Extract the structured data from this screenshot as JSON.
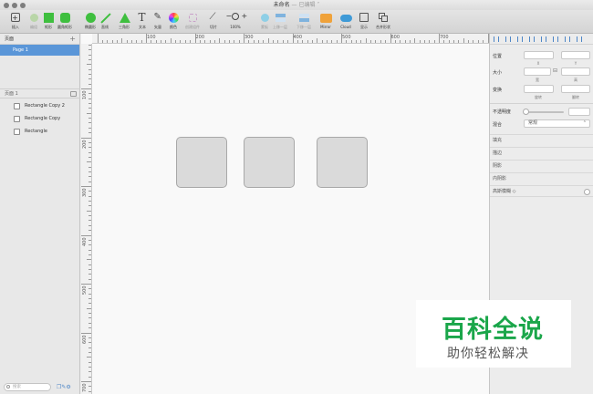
{
  "window": {
    "title": "未命名",
    "subtitle": " — 已编辑 ˅"
  },
  "toolbar": {
    "tools": [
      {
        "label": "插入",
        "icon": "plus-icon"
      },
      {
        "label": "编组",
        "icon": "group-icon"
      },
      {
        "label": "矩形",
        "icon": "rectangle-icon"
      },
      {
        "label": "圆角矩形",
        "icon": "rounded-rectangle-icon"
      },
      {
        "label": "椭圆形",
        "icon": "oval-icon"
      },
      {
        "label": "直线",
        "icon": "line-icon"
      },
      {
        "label": "三角形",
        "icon": "triangle-icon"
      },
      {
        "label": "文本",
        "icon": "text-icon"
      },
      {
        "label": "矢量",
        "icon": "vector-pen-icon"
      },
      {
        "label": "颜色",
        "icon": "color-wheel-icon"
      },
      {
        "label": "创建组件",
        "icon": "symbol-icon"
      },
      {
        "label": "切片",
        "icon": "slice-icon"
      },
      {
        "label": "100%",
        "icon": "zoom-icon"
      },
      {
        "label": "蒙板",
        "icon": "mask-icon"
      },
      {
        "label": "上移一层",
        "icon": "forward-icon"
      },
      {
        "label": "下移一层",
        "icon": "backward-icon"
      },
      {
        "label": "Mirror",
        "icon": "mirror-icon"
      },
      {
        "label": "Cloud",
        "icon": "cloud-icon"
      },
      {
        "label": "显示",
        "icon": "view-icon"
      },
      {
        "label": "合并形状",
        "icon": "combine-shapes-icon"
      }
    ]
  },
  "left_panel": {
    "pages_header": "页面",
    "add_page": "+",
    "pages": [
      "Page 1"
    ],
    "layers_header": "页面 1",
    "layers": [
      "Rectangle Copy 2",
      "Rectangle Copy",
      "Rectangle"
    ],
    "search_placeholder": "搜索"
  },
  "rulers": {
    "top_labels": [
      "100",
      "200",
      "300",
      "400",
      "500",
      "600",
      "700"
    ],
    "left_labels": [
      "100",
      "200",
      "300",
      "400",
      "500",
      "600",
      "700"
    ]
  },
  "inspector": {
    "position_label": "位置",
    "x_label": "X",
    "y_label": "Y",
    "size_label": "大小",
    "width_label": "宽",
    "height_label": "高",
    "transform_label": "变换",
    "rotate_label": "旋转",
    "flip_label": "翻转",
    "opacity_label": "不透明度",
    "blend_label": "混合",
    "blend_value": "常规",
    "fill_label": "填充",
    "border_label": "描边",
    "shadow_label": "阴影",
    "inner_shadow_label": "内阴影",
    "blur_label": "高斯模糊 ◇"
  },
  "watermark": {
    "title": "百科全说",
    "subtitle": "助你轻松解决"
  },
  "colors": {
    "selection": "#5a96d8",
    "shape_fill": "#dadada",
    "shape_border": "#a8a8a8",
    "watermark_green": "#1aa64a"
  }
}
